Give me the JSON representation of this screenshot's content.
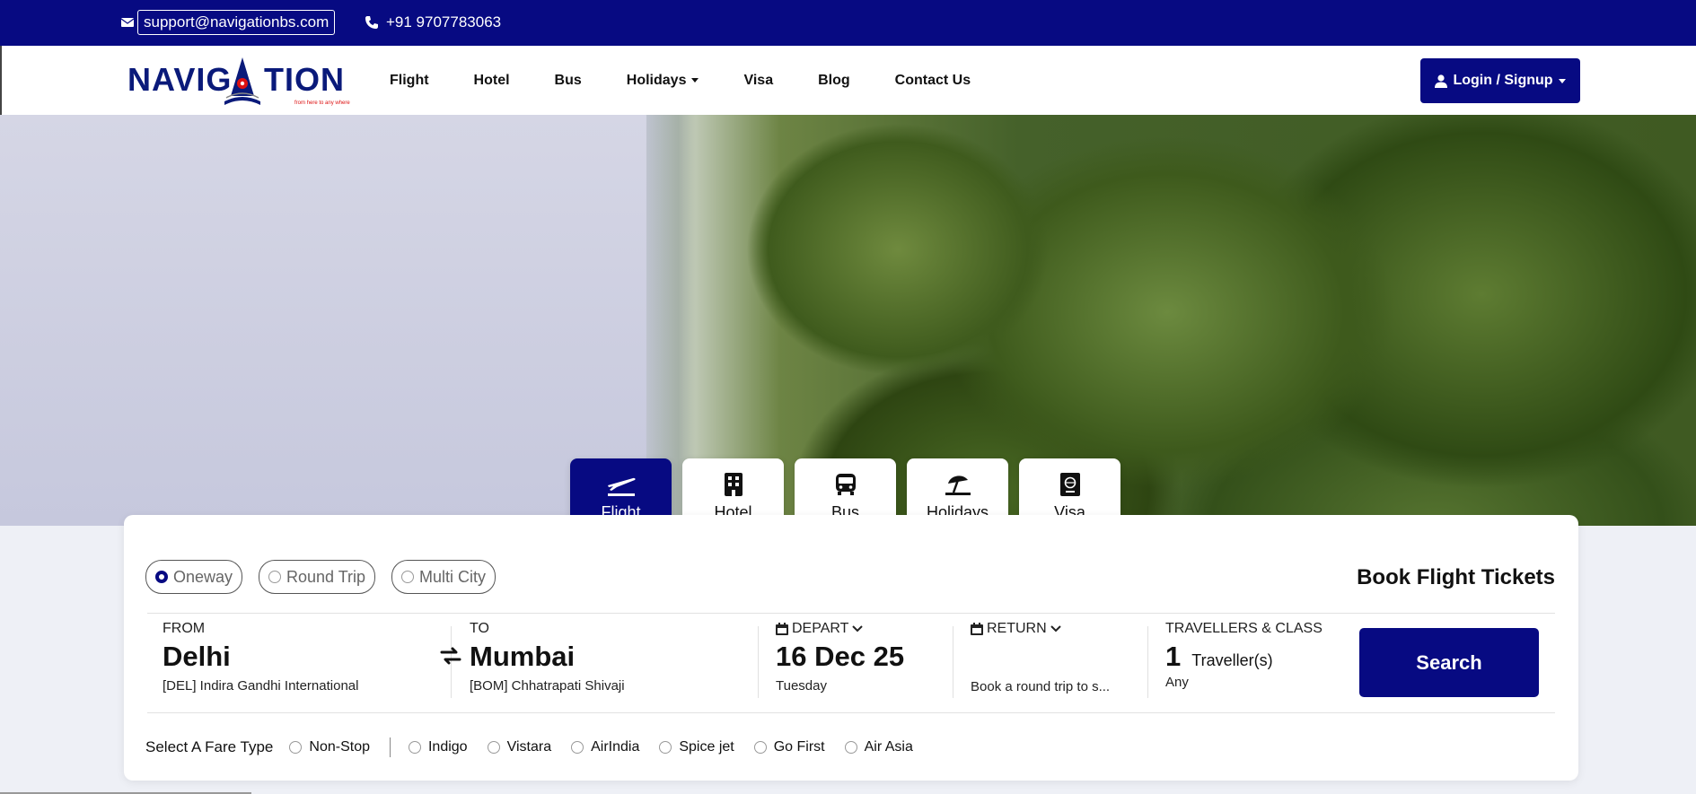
{
  "topbar": {
    "email": "support@navigationbs.com",
    "phone": "+91 9707783063"
  },
  "brand": {
    "logo_text": "NAVIGATION",
    "tagline": "from here to any where"
  },
  "nav": {
    "items": [
      {
        "label": "Flight"
      },
      {
        "label": "Hotel"
      },
      {
        "label": "Bus"
      },
      {
        "label": "Holidays"
      },
      {
        "label": "Visa"
      },
      {
        "label": "Blog"
      },
      {
        "label": "Contact Us"
      }
    ],
    "login_label": "Login / Signup"
  },
  "tabs": [
    {
      "label": "Flight",
      "icon": "plane-icon"
    },
    {
      "label": "Hotel",
      "icon": "building-icon"
    },
    {
      "label": "Bus",
      "icon": "bus-icon"
    },
    {
      "label": "Holidays",
      "icon": "umbrella-beach-icon"
    },
    {
      "label": "Visa",
      "icon": "passport-icon"
    }
  ],
  "trip_types": [
    {
      "label": "Oneway",
      "selected": true
    },
    {
      "label": "Round Trip",
      "selected": false
    },
    {
      "label": "Multi City",
      "selected": false
    }
  ],
  "book_title": "Book Flight Tickets",
  "search_form": {
    "from": {
      "label": "FROM",
      "city": "Delhi",
      "airport": "[DEL] Indira Gandhi International"
    },
    "to": {
      "label": "TO",
      "city": "Mumbai",
      "airport": "[BOM] Chhatrapati Shivaji"
    },
    "depart": {
      "label": "DEPART",
      "date": "16 Dec 25",
      "day": "Tuesday"
    },
    "return": {
      "label": "RETURN",
      "hint": "Book a round trip to s..."
    },
    "travellers": {
      "label": "TRAVELLERS & CLASS",
      "count": "1",
      "unit": "Traveller(s)",
      "class": "Any"
    },
    "search_label": "Search"
  },
  "fare": {
    "label": "Select A Fare Type",
    "options": [
      "Non-Stop",
      "Indigo",
      "Vistara",
      "AirIndia",
      "Spice jet",
      "Go First",
      "Air Asia"
    ]
  },
  "colors": {
    "primary": "#070a82",
    "background": "#eef0f6"
  }
}
